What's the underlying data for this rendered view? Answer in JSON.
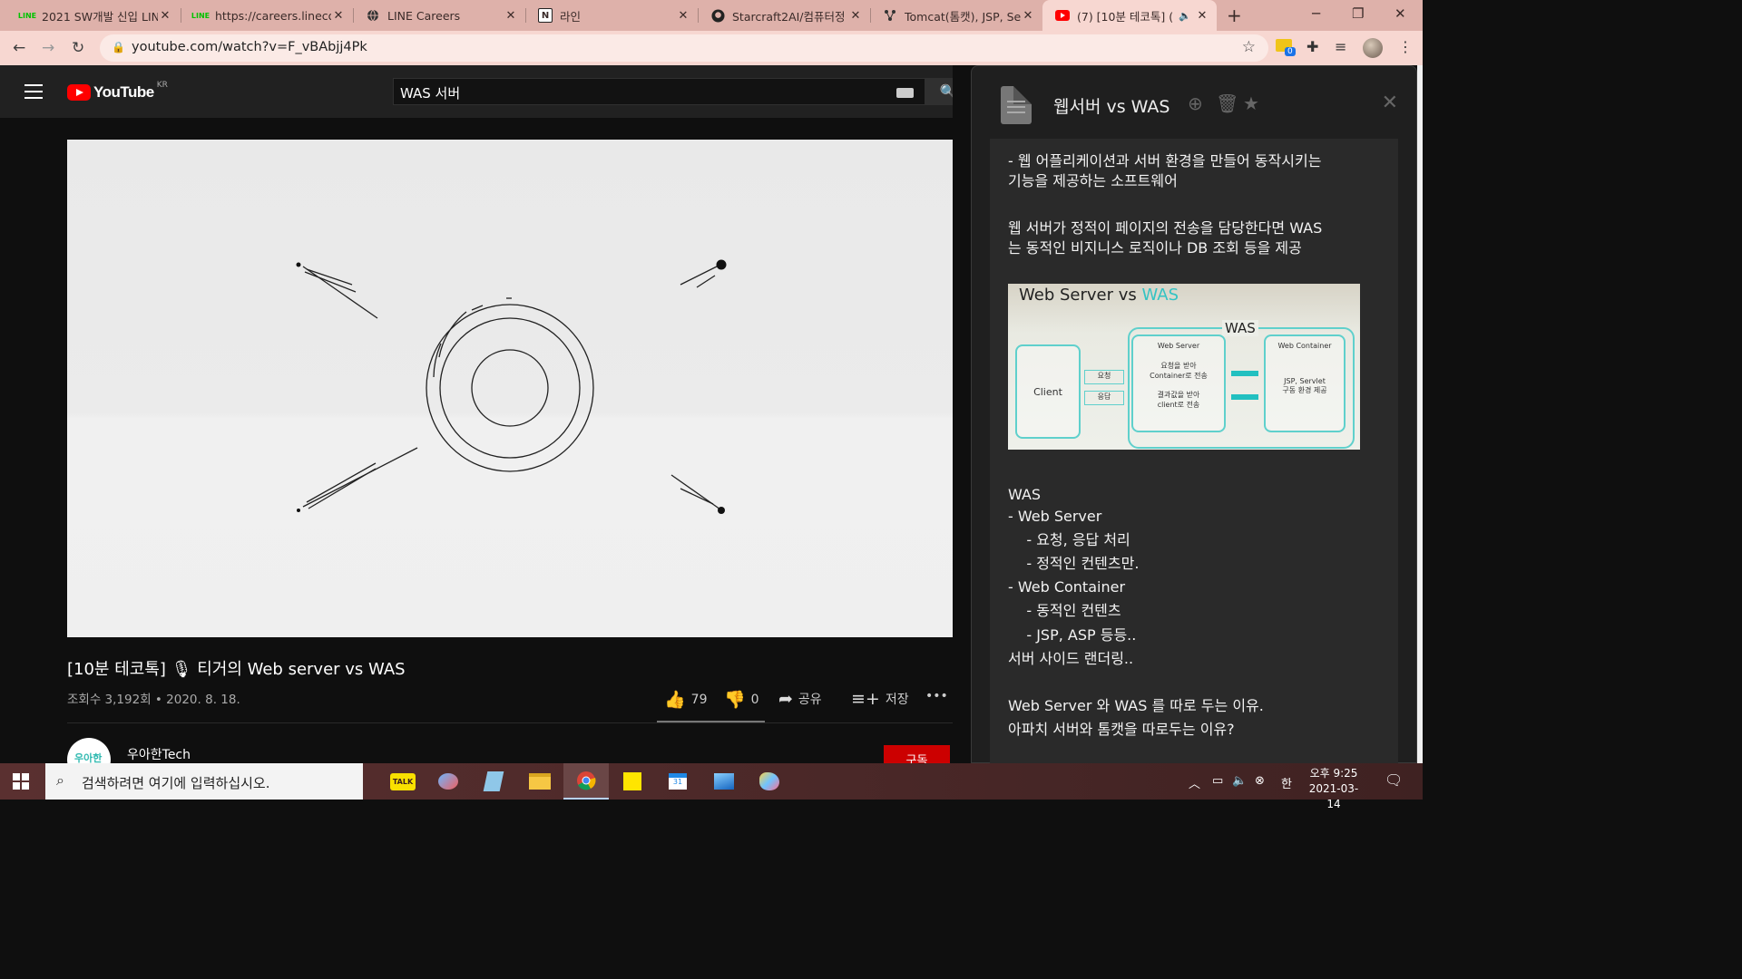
{
  "browser": {
    "tabs": [
      {
        "title": "2021 SW개발 신입 LIN",
        "icon": "line-icon",
        "active": false
      },
      {
        "title": "https://careers.linecorp",
        "icon": "line-icon",
        "active": false
      },
      {
        "title": "LINE Careers",
        "icon": "globe-icon",
        "active": false
      },
      {
        "title": "라인",
        "icon": "notion-icon",
        "active": false
      },
      {
        "title": "Starcraft2AI/컴퓨터정",
        "icon": "github-icon",
        "active": false
      },
      {
        "title": "Tomcat(톰캣), JSP, Ser",
        "icon": "tree-icon",
        "active": false
      },
      {
        "title": "(7) [10분 테코톡] (",
        "icon": "youtube-icon",
        "active": true
      }
    ],
    "url": "youtube.com/watch?v=F_vBAbjj4Pk",
    "extension_badge": "0"
  },
  "youtube": {
    "logo_text": "YouTube",
    "region": "KR",
    "search_query": "WAS 서버",
    "video_title": "[10분 테코톡] 🎙 티거의 Web server vs WAS",
    "views_date": "조회수 3,192회 • 2020. 8. 18.",
    "likes": "79",
    "dislikes": "0",
    "share_label": "공유",
    "save_label": "저장",
    "more_label": "•••",
    "channel_name": "우아한Tech",
    "channel_avatar_text": "우아한",
    "subscribe_label": "구독"
  },
  "note": {
    "title": "웹서버 vs WAS",
    "lines_top": [
      " - 웹 어플리케이션과 서버 환경을 만들어 동작시키는",
      "기능을 제공하는 소프트웨어",
      "",
      " 웹 서버가 정적이 페이지의 전송을 담당한다면 WAS",
      "는 동적인 비지니스 로직이나 DB 조회 등을 제공"
    ],
    "diagram": {
      "heading_a": "Web Server vs ",
      "heading_b": "WAS",
      "was_label": "WAS",
      "client": "Client",
      "request": "요청",
      "response": "응답",
      "web_server": "Web Server",
      "ws_line1": "요청을 받아",
      "ws_line2": "Container로 전송",
      "ws_line3": "결과값을 받아",
      "ws_line4": "client로 전송",
      "web_container": "Web Container",
      "wc_line1": "JSP, Servlet",
      "wc_line2": "구동 환경 제공"
    },
    "lines_bottom": [
      "WAS",
      "- Web Server",
      "    - 요청, 응답 처리",
      "    - 정적인 컨텐츠만.",
      "- Web Container",
      "    - 동적인 컨텐츠",
      "    - JSP, ASP 등등..",
      "서버 사이드 랜더링..",
      "",
      "Web Server 와 WAS 를 따로 두는 이유.",
      "아파치 서버와 톰캣을 따로두는 이유?"
    ]
  },
  "taskbar": {
    "search_placeholder": "검색하려면 여기에 입력하십시오.",
    "ime": "한",
    "time": "오후 9:25",
    "date": "2021-03-14",
    "apps": [
      "kakaotalk-icon",
      "paint-icon",
      "notepad-icon",
      "file-explorer-icon",
      "chrome-icon",
      "sticky-notes-icon",
      "calendar-icon",
      "photos-icon",
      "paint3d-icon"
    ]
  }
}
